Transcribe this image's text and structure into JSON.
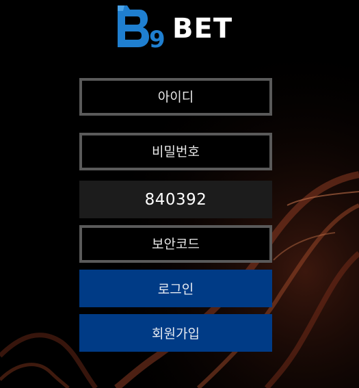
{
  "brand": {
    "logo_text": "BET",
    "logo_mark": "B",
    "logo_digit": "9",
    "accent": "#1f7fd0"
  },
  "form": {
    "username_placeholder": "아이디",
    "password_placeholder": "비밀번호",
    "captcha_code": "840392",
    "security_code_placeholder": "보안코드"
  },
  "buttons": {
    "login_label": "로그인",
    "signup_label": "회원가입",
    "color": "#003b86"
  }
}
